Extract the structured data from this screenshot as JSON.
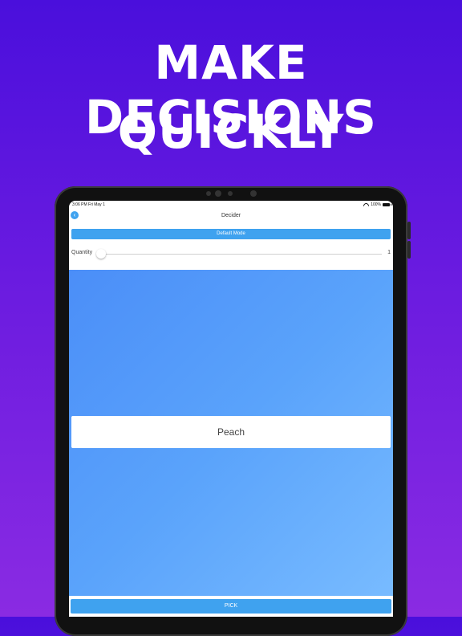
{
  "headline": {
    "line1": "MAKE DECISIONS",
    "line2": "QUICKLY"
  },
  "status": {
    "time": "3:06 PM   Fri May 1",
    "battery": "100%"
  },
  "nav": {
    "title": "Decider",
    "back_icon": "chevron-left-icon"
  },
  "mode": {
    "label": "Default Mode"
  },
  "quantity": {
    "label": "Quantity",
    "value": "1",
    "fraction": 0.0
  },
  "result": {
    "text": "Peach"
  },
  "pick": {
    "label": "PICK"
  },
  "colors": {
    "accent": "#3fa2ef",
    "background_top": "#4a0fdc",
    "background_bottom": "#8a2be2",
    "result_gradient_start": "#4b8ef8",
    "result_gradient_end": "#78bbff"
  }
}
